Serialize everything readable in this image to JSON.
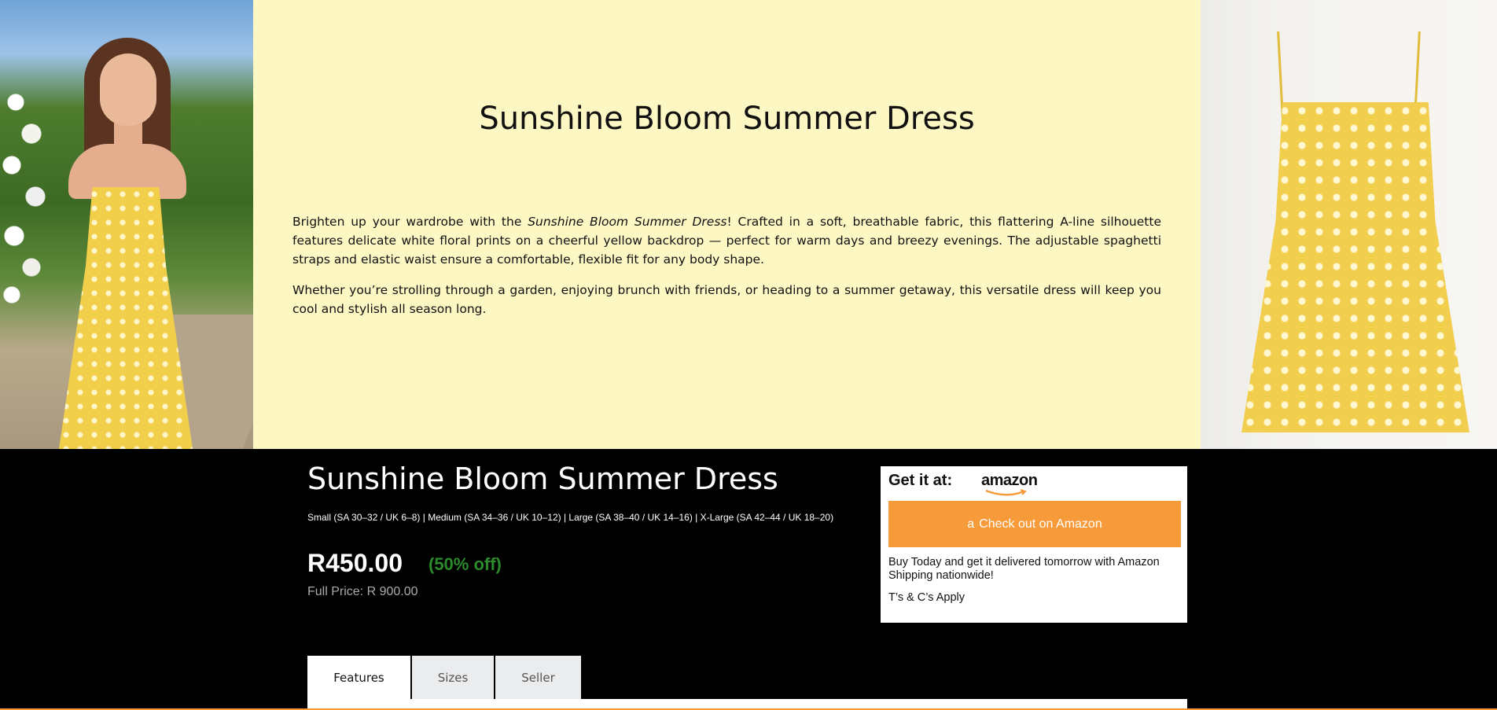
{
  "hero": {
    "title": "Sunshine Bloom Summer Dress",
    "desc1_pre": "Brighten up your wardrobe with the ",
    "desc1_em": "Sunshine Bloom Summer Dress",
    "desc1_post": "! Crafted in a soft, breathable fabric, this flattering A-line silhouette features delicate white floral prints on a cheerful yellow backdrop — perfect for warm days and breezy evenings. The adjustable spaghetti straps and elastic waist ensure a comfortable, flexible fit for any body shape.",
    "desc2": "Whether you’re strolling through a garden, enjoying brunch with friends, or heading to a summer getaway, this versatile dress will keep you cool and stylish all season long."
  },
  "product": {
    "title": "Sunshine Bloom Summer Dress",
    "sizes": "Small (SA 30–32 / UK 6–8) | Medium (SA 34–36 / UK 10–12) | Large (SA 38–40 / UK 14–16) | X-Large (SA 42–44 / UK 18–20)",
    "price": "R450.00",
    "discount": "(50% off)",
    "full_price": "Full Price: R 900.00"
  },
  "buybox": {
    "get_label": "Get it at:",
    "logo_text": "amazon",
    "button_icon": "a",
    "button_label": "Check out on Amazon",
    "note": "Buy Today and get it delivered tomorrow with Amazon Shipping nationwide!",
    "terms": "T’s & C’s Apply"
  },
  "tabs": [
    {
      "label": "Features"
    },
    {
      "label": "Sizes"
    },
    {
      "label": "Seller"
    }
  ],
  "colors": {
    "hero_bg": "#fdf7c3",
    "accent_orange": "#f79b3a",
    "discount_green": "#2b8a2b"
  }
}
